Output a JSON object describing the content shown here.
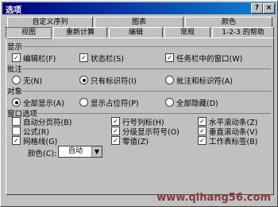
{
  "window": {
    "title": "选项",
    "help": "?",
    "close": "×"
  },
  "tabs_row1": [
    "自定义序列",
    "图表",
    "颜色"
  ],
  "tabs_row2": [
    "视图",
    "重新计算",
    "编辑",
    "常规",
    "1-2-3 的帮助"
  ],
  "groups": {
    "show": {
      "label": "显示",
      "items": [
        {
          "label": "编辑栏(F)",
          "checked": true
        },
        {
          "label": "状态栏(S)",
          "checked": true
        },
        {
          "label": "任务栏中的窗口(W)",
          "checked": true
        }
      ]
    },
    "comment": {
      "label": "批注",
      "items": [
        {
          "label": "无(N)",
          "selected": false
        },
        {
          "label": "只有标识符(I)",
          "selected": true
        },
        {
          "label": "批注和标识符(A)",
          "selected": false
        }
      ]
    },
    "objects": {
      "label": "对象",
      "items": [
        {
          "label": "全部显示(A)",
          "selected": true
        },
        {
          "label": "显示占位符(P)",
          "selected": false
        },
        {
          "label": "全部隐藏(D)",
          "selected": false
        }
      ]
    },
    "window_options": {
      "label": "窗口选项",
      "items": [
        {
          "label": "自动分页符(B)",
          "checked": false
        },
        {
          "label": "公式(R)",
          "checked": false
        },
        {
          "label": "网格线(G)",
          "checked": true
        },
        {
          "label": "行号列标(H)",
          "checked": true
        },
        {
          "label": "分级显示符号(O)",
          "checked": true
        },
        {
          "label": "零值(Z)",
          "checked": true
        },
        {
          "label": "水平滚动条(Z)",
          "checked": true
        },
        {
          "label": "垂直滚动条(V)",
          "checked": true
        },
        {
          "label": "工作表标签(B)",
          "checked": true
        }
      ],
      "color_label": "颜色(C):",
      "color_value": "自动"
    }
  },
  "watermark": "www.qihang56.com"
}
